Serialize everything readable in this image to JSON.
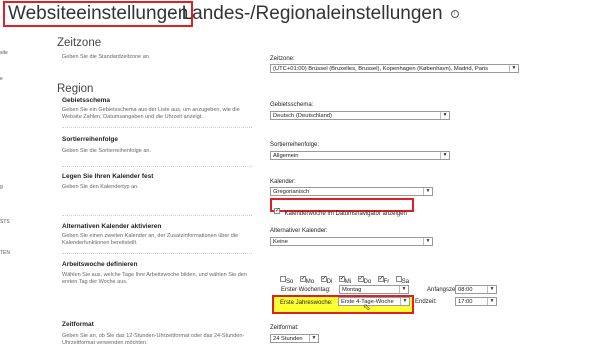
{
  "header": {
    "site_settings": "Websiteeinstellungen",
    "separator": "·",
    "page_title": "Landes-/Regionaleinstellungen",
    "info_glyph": "i"
  },
  "left_nav": {
    "items": [
      "site",
      "e",
      "g",
      "STS",
      "TEN"
    ]
  },
  "timezone": {
    "section_title": "Zeitzone",
    "description": "Geben Sie die Standardzeitzone an.",
    "label": "Zeitzone:",
    "value": "(UTC+01:00) Brüssel (Bruxelles, Brussel), Kopenhagen (København), Madrid, Paris"
  },
  "region": {
    "section_title": "Region",
    "locale": {
      "title": "Gebietsschema",
      "description": "Geben Sie ein Gebietsschema aus der Liste aus, um anzugeben, wie die Website Zahlen, Datumsangaben und die Uhrzeit anzeigt.",
      "label": "Gebietsschema:",
      "value": "Deutsch (Deutschland)"
    },
    "sort_order": {
      "title": "Sortierreihenfolge",
      "description": "Geben Sie die Sortierreihenfolge an.",
      "label": "Sortierreihenfolge:",
      "value": "Allgemein"
    },
    "calendar": {
      "title": "Legen Sie Ihren Kalender fest",
      "description": "Geben Sie den Kalendertyp an.",
      "label": "Kalender:",
      "value": "Gregorianisch",
      "week_numbers_label": "Kalenderwoche im Datumsnavigator anzeigen",
      "week_numbers_checked": true
    },
    "alt_calendar": {
      "title": "Alternativen Kalender aktivieren",
      "description": "Geben Sie einen zweiten Kalender an, der Zusatzinformationen über die Kalenderfunktionen bereitstellt.",
      "label": "Alternativer Kalender:",
      "value": "Keine"
    },
    "work_week": {
      "title": "Arbeitswoche definieren",
      "description": "Wählen Sie aus, welche Tage Ihre Arbeitswoche bilden, und wählen Sie den ersten Tag der Woche aus.",
      "days": [
        {
          "label": "So",
          "checked": false
        },
        {
          "label": "Mo",
          "checked": true
        },
        {
          "label": "Di",
          "checked": true
        },
        {
          "label": "Mi",
          "checked": true
        },
        {
          "label": "Do",
          "checked": true
        },
        {
          "label": "Fr",
          "checked": true
        },
        {
          "label": "Sa",
          "checked": false
        }
      ],
      "first_weekday_label": "Erster Wochentag:",
      "first_weekday_value": "Montag",
      "start_time_label": "Anfangszeit:",
      "start_time_value": "08:00",
      "first_week_label": "Erste Jahreswoche:",
      "first_week_value": "Erste 4-Tage-Woche",
      "end_time_label": "Endzeit:",
      "end_time_value": "17:00"
    },
    "time_format": {
      "title": "Zeitformat",
      "description": "Geben Sie an, ob Sie das 12-Stunden-Uhrzeitformat oder das 24-Stunden-Uhrzeitformat verwenden möchten.",
      "label": "Zeitformat:",
      "value": "24 Stunden"
    }
  },
  "icons": {
    "dropdown_arrow": "chevron-down-icon",
    "checkmark": "check-icon"
  },
  "colors": {
    "annotation_red": "#e02020",
    "highlight_yellow": "#ffff33"
  }
}
